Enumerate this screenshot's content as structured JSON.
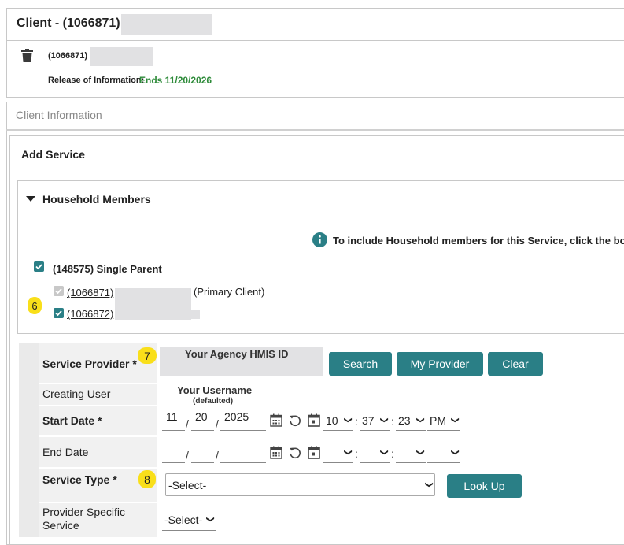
{
  "client_header": {
    "title": "Client - (1066871)",
    "client_id": "(1066871)",
    "roi_label": "Release of Information:",
    "roi_value": "Ends 11/20/2026"
  },
  "client_info_tab": "Client Information",
  "add_service": {
    "title": "Add Service",
    "household": {
      "title": "Household Members",
      "info_text": "To include Household members for this Service, click the box b",
      "household_label": "(148575) Single Parent",
      "members": [
        {
          "id": "(1066871)",
          "suffix": "(Primary Client)"
        },
        {
          "id": "(1066872)",
          "suffix": ""
        }
      ]
    }
  },
  "badges": {
    "members": "6",
    "provider": "7",
    "service_type": "8"
  },
  "form": {
    "service_provider_label": "Service Provider *",
    "service_provider_value": "Your Agency HMIS ID",
    "search_btn": "Search",
    "my_provider_btn": "My Provider",
    "clear_btn": "Clear",
    "creating_user_label": "Creating User",
    "creating_user_value": "Your Username",
    "creating_user_note": "(defaulted)",
    "start_date_label": "Start Date *",
    "start_month": "11",
    "start_day": "20",
    "start_year": "2025",
    "start_hour": "10",
    "start_minute": "37",
    "start_second": "23",
    "start_ampm": "PM",
    "end_date_label": "End Date",
    "service_type_label": "Service Type *",
    "service_type_value": "-Select-",
    "lookup_btn": "Look Up",
    "provider_specific_label": "Provider Specific Service",
    "provider_specific_value": "-Select-",
    "date_sep": "/",
    "time_sep": ":"
  },
  "colors": {
    "accent": "#2a7f86",
    "roi_green": "#2e8b3a",
    "badge": "#f9df1a"
  }
}
